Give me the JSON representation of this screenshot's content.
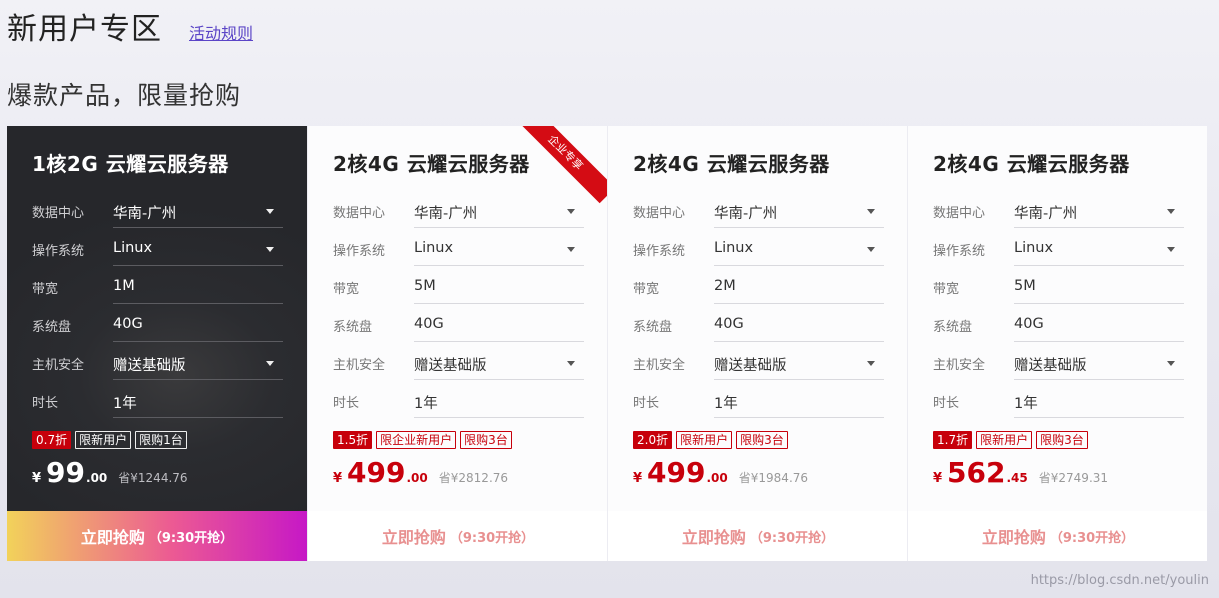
{
  "header": {
    "title": "新用户专区",
    "rules_link": "活动规则"
  },
  "subtitle": "爆款产品，限量抢购",
  "labels": {
    "region": "数据中心",
    "os": "操作系统",
    "bandwidth": "带宽",
    "disk": "系统盘",
    "security": "主机安全",
    "duration": "时长"
  },
  "cards": [
    {
      "title": "1核2G 云耀云服务器",
      "region": "华南-广州",
      "os": "Linux",
      "bandwidth": "1M",
      "disk": "40G",
      "security": "赠送基础版",
      "duration": "1年",
      "tags": {
        "discount": "0.7折",
        "user": "限新用户",
        "limit": "限购1台"
      },
      "price": {
        "currency": "¥",
        "int": "99",
        "dec": ".00",
        "save": "省¥1244.76"
      },
      "button": {
        "main": "立即抢购",
        "sub": "（9:30开抢）"
      }
    },
    {
      "title": "2核4G 云耀云服务器",
      "ribbon": "企业专享",
      "region": "华南-广州",
      "os": "Linux",
      "bandwidth": "5M",
      "disk": "40G",
      "security": "赠送基础版",
      "duration": "1年",
      "tags": {
        "discount": "1.5折",
        "user": "限企业新用户",
        "limit": "限购3台"
      },
      "price": {
        "currency": "¥",
        "int": "499",
        "dec": ".00",
        "save": "省¥2812.76"
      },
      "button": {
        "main": "立即抢购",
        "sub": "（9:30开抢）"
      }
    },
    {
      "title": "2核4G 云耀云服务器",
      "region": "华南-广州",
      "os": "Linux",
      "bandwidth": "2M",
      "disk": "40G",
      "security": "赠送基础版",
      "duration": "1年",
      "tags": {
        "discount": "2.0折",
        "user": "限新用户",
        "limit": "限购3台"
      },
      "price": {
        "currency": "¥",
        "int": "499",
        "dec": ".00",
        "save": "省¥1984.76"
      },
      "button": {
        "main": "立即抢购",
        "sub": "（9:30开抢）"
      }
    },
    {
      "title": "2核4G 云耀云服务器",
      "region": "华南-广州",
      "os": "Linux",
      "bandwidth": "5M",
      "disk": "40G",
      "security": "赠送基础版",
      "duration": "1年",
      "tags": {
        "discount": "1.7折",
        "user": "限新用户",
        "limit": "限购3台"
      },
      "price": {
        "currency": "¥",
        "int": "562",
        "dec": ".45",
        "save": "省¥2749.31"
      },
      "button": {
        "main": "立即抢购",
        "sub": "（9:30开抢）"
      }
    }
  ],
  "watermark": "https://blog.csdn.net/youlin",
  "colors": {
    "accent": "#c7000b",
    "link": "#5b45c7",
    "button_text": "#e89090",
    "featured_bg": "#2b2c30"
  }
}
